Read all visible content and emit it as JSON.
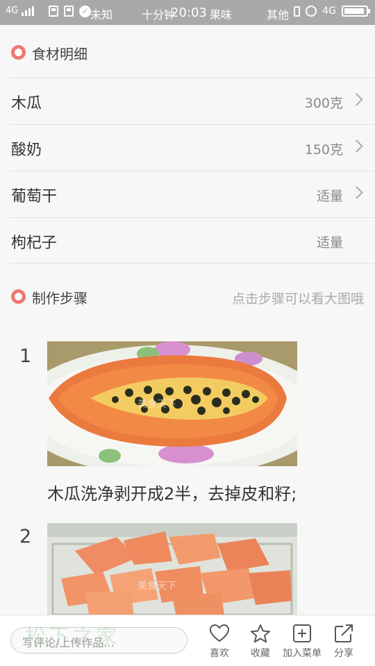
{
  "status_bar": {
    "network": "4G",
    "text1": "未知",
    "text2": "十分钟",
    "time": "20:03",
    "text3": "果味",
    "text4": "其他",
    "network_right": "4G"
  },
  "ingredients_section": {
    "title": "食材明细"
  },
  "ingredients": [
    {
      "name": "木瓜",
      "amount": "300克"
    },
    {
      "name": "酸奶",
      "amount": "150克"
    },
    {
      "name": "葡萄干",
      "amount": "适量"
    },
    {
      "name": "枸杞子",
      "amount": "适量"
    }
  ],
  "steps_section": {
    "title": "制作步骤",
    "hint": "点击步骤可以看大图哦"
  },
  "steps": [
    {
      "number": "1",
      "description": "木瓜洗净剥开成2半，去掉皮和籽;",
      "watermark": "美食天下"
    },
    {
      "number": "2",
      "description": "",
      "watermark": "美食天下"
    }
  ],
  "bottom_bar": {
    "comment_placeholder": "写评论/上传作品...",
    "watermark": "松下之家",
    "actions": [
      {
        "label": "喜欢",
        "icon": "heart-icon"
      },
      {
        "label": "收藏",
        "icon": "star-icon"
      },
      {
        "label": "加入菜单",
        "icon": "add-menu-icon"
      },
      {
        "label": "分享",
        "icon": "share-icon"
      }
    ]
  },
  "colors": {
    "accent": "#f07672",
    "status_bar": "#a9a9a9"
  }
}
